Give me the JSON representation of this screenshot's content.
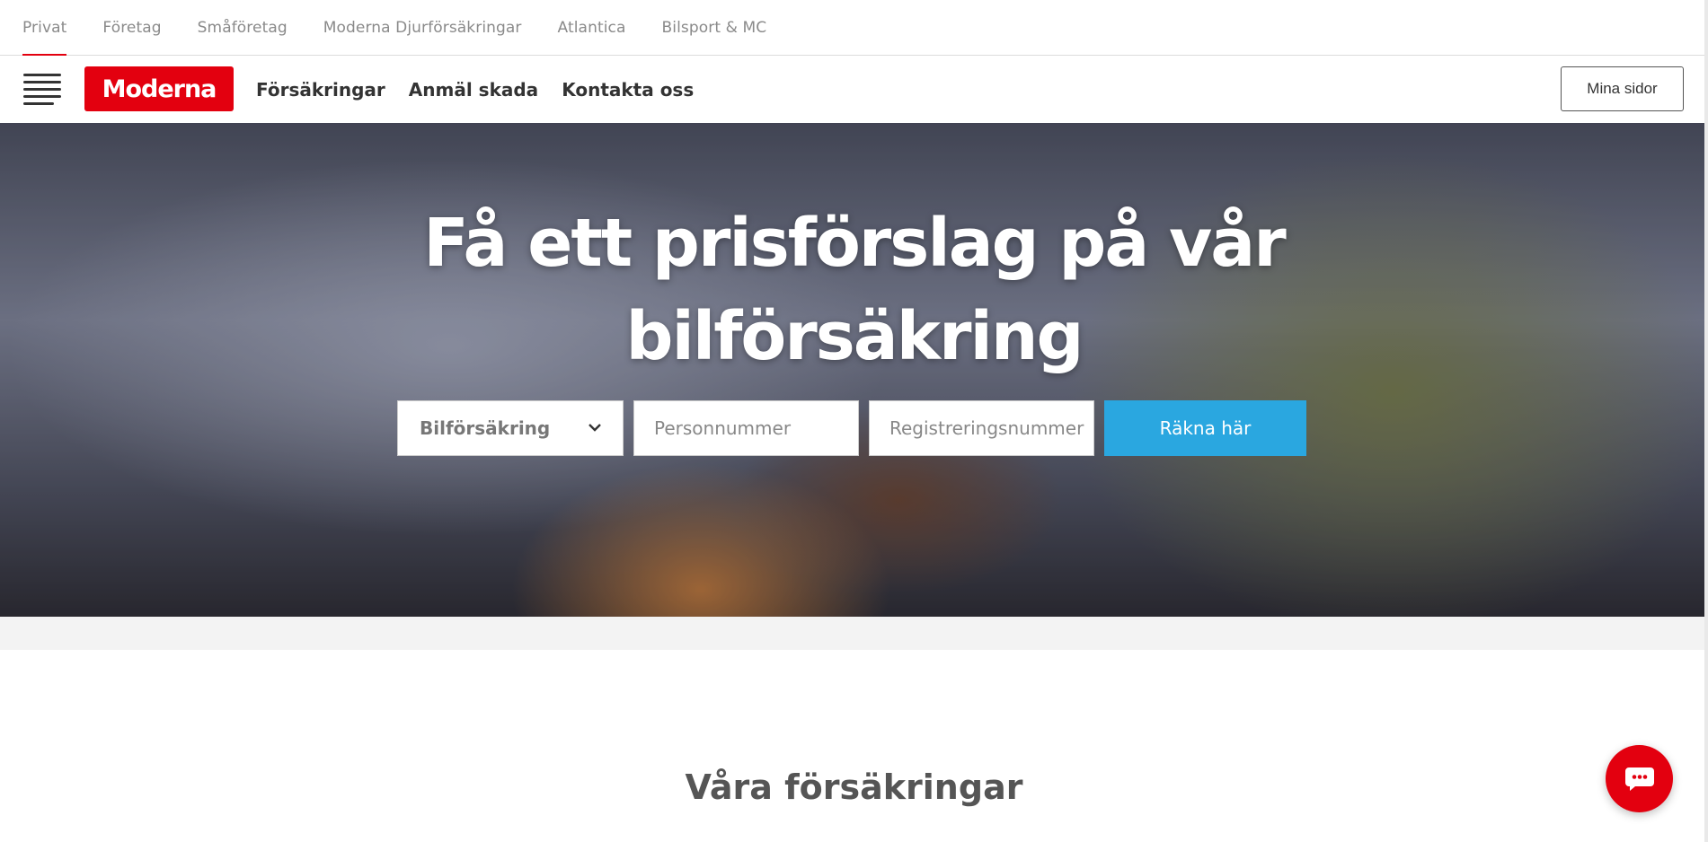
{
  "segments": [
    {
      "label": "Privat",
      "active": true
    },
    {
      "label": "Företag"
    },
    {
      "label": "Småföretag"
    },
    {
      "label": "Moderna Djurförsäkringar"
    },
    {
      "label": "Atlantica"
    },
    {
      "label": "Bilsport & MC"
    }
  ],
  "brand": {
    "logo_text": "Moderna",
    "color": "#e3000f"
  },
  "nav": {
    "links": [
      "Försäkringar",
      "Anmäl skada",
      "Kontakta oss"
    ],
    "account_button": "Mina sidor"
  },
  "hero": {
    "title_line1": "Få ett prisförslag på vår",
    "title_line2": "bilförsäkring",
    "form": {
      "insurance_type": "Bilförsäkring",
      "personnummer_placeholder": "Personnummer",
      "regnr_placeholder": "Registreringsnummer",
      "submit_label": "Räkna här",
      "submit_color": "#2aa7e0"
    }
  },
  "section": {
    "title": "Våra försäkringar"
  },
  "chat": {
    "icon": "chat-bubble-icon"
  }
}
